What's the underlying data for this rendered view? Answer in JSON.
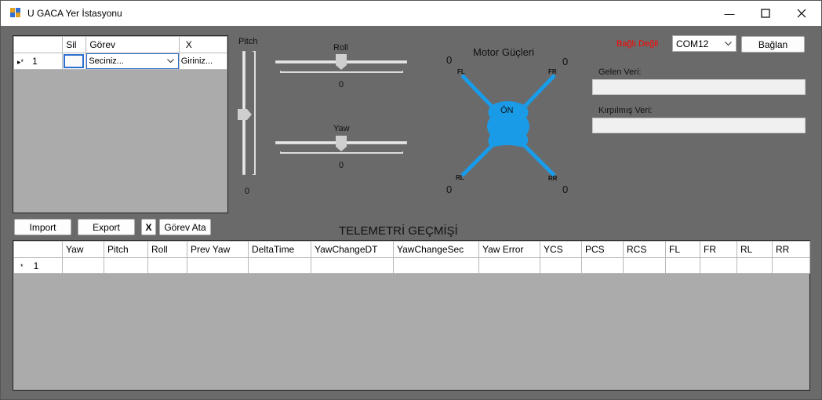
{
  "window": {
    "title": "U GACA Yer İstasyonu",
    "minimize_glyph": "—",
    "maximize_glyph": "☐",
    "close_glyph": "✕"
  },
  "task_grid": {
    "columns": [
      "Sil",
      "Görev",
      "X"
    ],
    "rows": [
      {
        "row_head": "1",
        "row_marker": "▸*",
        "gorev": "Seciniz...",
        "x_value": "Giriniz..."
      }
    ]
  },
  "buttons": {
    "import": "Import",
    "export": "Export",
    "x": "X",
    "gorev_ata": "Görev Ata",
    "baglan": "Bağlan"
  },
  "sliders": {
    "pitch_label": "Pitch",
    "pitch_value": "0",
    "roll_label": "Roll",
    "roll_value": "0",
    "yaw_label": "Yaw",
    "yaw_value": "0"
  },
  "motor": {
    "title": "Motor Güçleri",
    "front_label": "ÖN",
    "fl_label": "FL",
    "fr_label": "FR",
    "rl_label": "RL",
    "rr_label": "RR",
    "fl_value": "0",
    "fr_value": "0",
    "rl_value": "0",
    "rr_value": "0",
    "color": "#1a9be8"
  },
  "connection": {
    "status": "Bağlı Değil",
    "status_color": "#ff0000",
    "port": "COM12",
    "incoming_label": "Gelen Veri:",
    "trimmed_label": "Kırpılmış Veri:"
  },
  "telemetry": {
    "title": "TELEMETRİ GEÇMİŞİ",
    "columns": [
      "Yaw",
      "Pitch",
      "Roll",
      "Prev Yaw",
      "DeltaTime",
      "YawChangeDT",
      "YawChangeSec",
      "Yaw Error",
      "YCS",
      "PCS",
      "RCS",
      "FL",
      "FR",
      "RL",
      "RR"
    ],
    "rows": [
      {
        "row_head": "1",
        "row_marker": "*"
      }
    ]
  }
}
